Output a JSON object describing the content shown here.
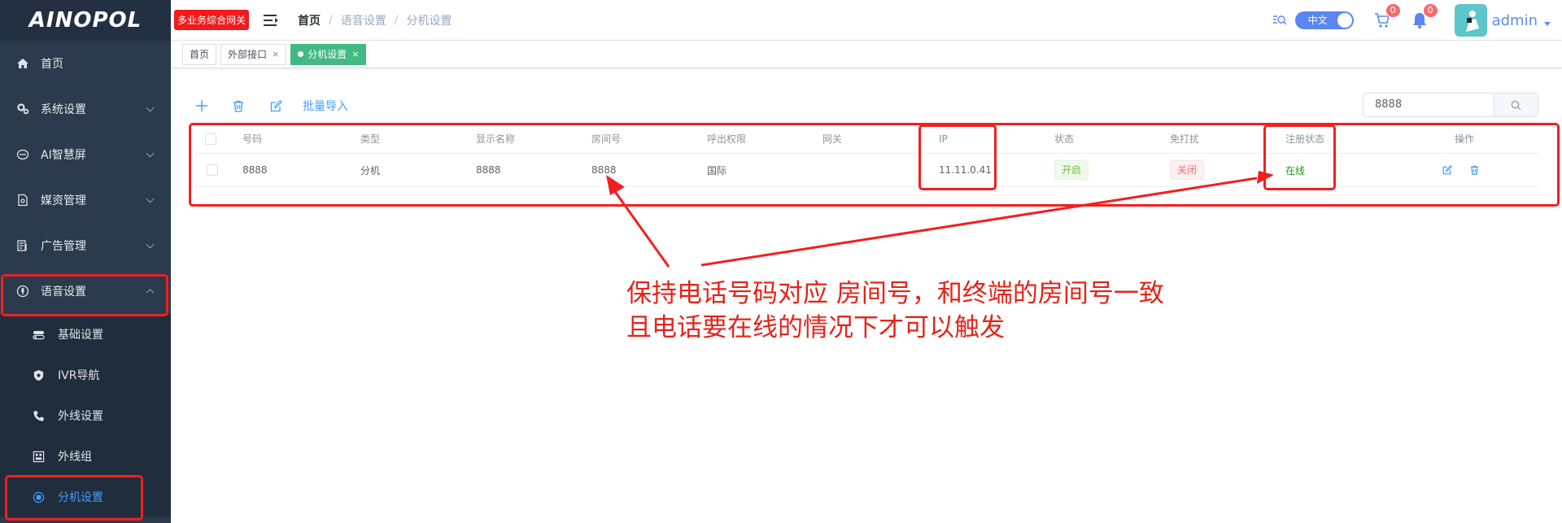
{
  "sidebar": {
    "logo": "AINOPOL",
    "items": [
      {
        "label": "首页",
        "icon": "home-icon"
      },
      {
        "label": "系统设置",
        "icon": "gears-icon"
      },
      {
        "label": "AI智慧屏",
        "icon": "screen-icon"
      },
      {
        "label": "媒资管理",
        "icon": "document-icon"
      },
      {
        "label": "广告管理",
        "icon": "ad-icon"
      },
      {
        "label": "语音设置",
        "icon": "voice-icon"
      }
    ],
    "submenu": [
      {
        "label": "基础设置",
        "icon": "toggle-icon"
      },
      {
        "label": "IVR导航",
        "icon": "shield-icon"
      },
      {
        "label": "外线设置",
        "icon": "phone-icon"
      },
      {
        "label": "外线组",
        "icon": "grid-icon"
      },
      {
        "label": "分机设置",
        "icon": "extension-icon"
      }
    ]
  },
  "header": {
    "gateway_badge": "多业务综合网关",
    "breadcrumb": [
      "首页",
      "语音设置",
      "分机设置"
    ],
    "lang_label": "中文",
    "cart_count": "0",
    "notify_count": "0",
    "username": "admin"
  },
  "tags": [
    {
      "label": "首页",
      "closable": false,
      "active": false
    },
    {
      "label": "外部接口",
      "closable": true,
      "active": false
    },
    {
      "label": "分机设置",
      "closable": true,
      "active": true
    }
  ],
  "toolbar": {
    "batch_import": "批量导入",
    "search_value": "8888"
  },
  "table": {
    "columns": [
      "号码",
      "类型",
      "显示名称",
      "房间号",
      "呼出权限",
      "网关",
      "IP",
      "状态",
      "免打扰",
      "注册状态",
      "操作"
    ],
    "rows": [
      {
        "number": "8888",
        "type": "分机",
        "display_name": "8888",
        "room": "8888",
        "call_permission": "国际",
        "gateway": "",
        "ip": "11.11.0.41",
        "status": "开启",
        "dnd": "关闭",
        "reg_status": "在线"
      }
    ]
  },
  "annotation": {
    "line1": "保持电话号码对应 房间号，和终端的房间号一致",
    "line2": "且电话要在线的情况下才可以触发",
    "color": "#e5231a"
  }
}
